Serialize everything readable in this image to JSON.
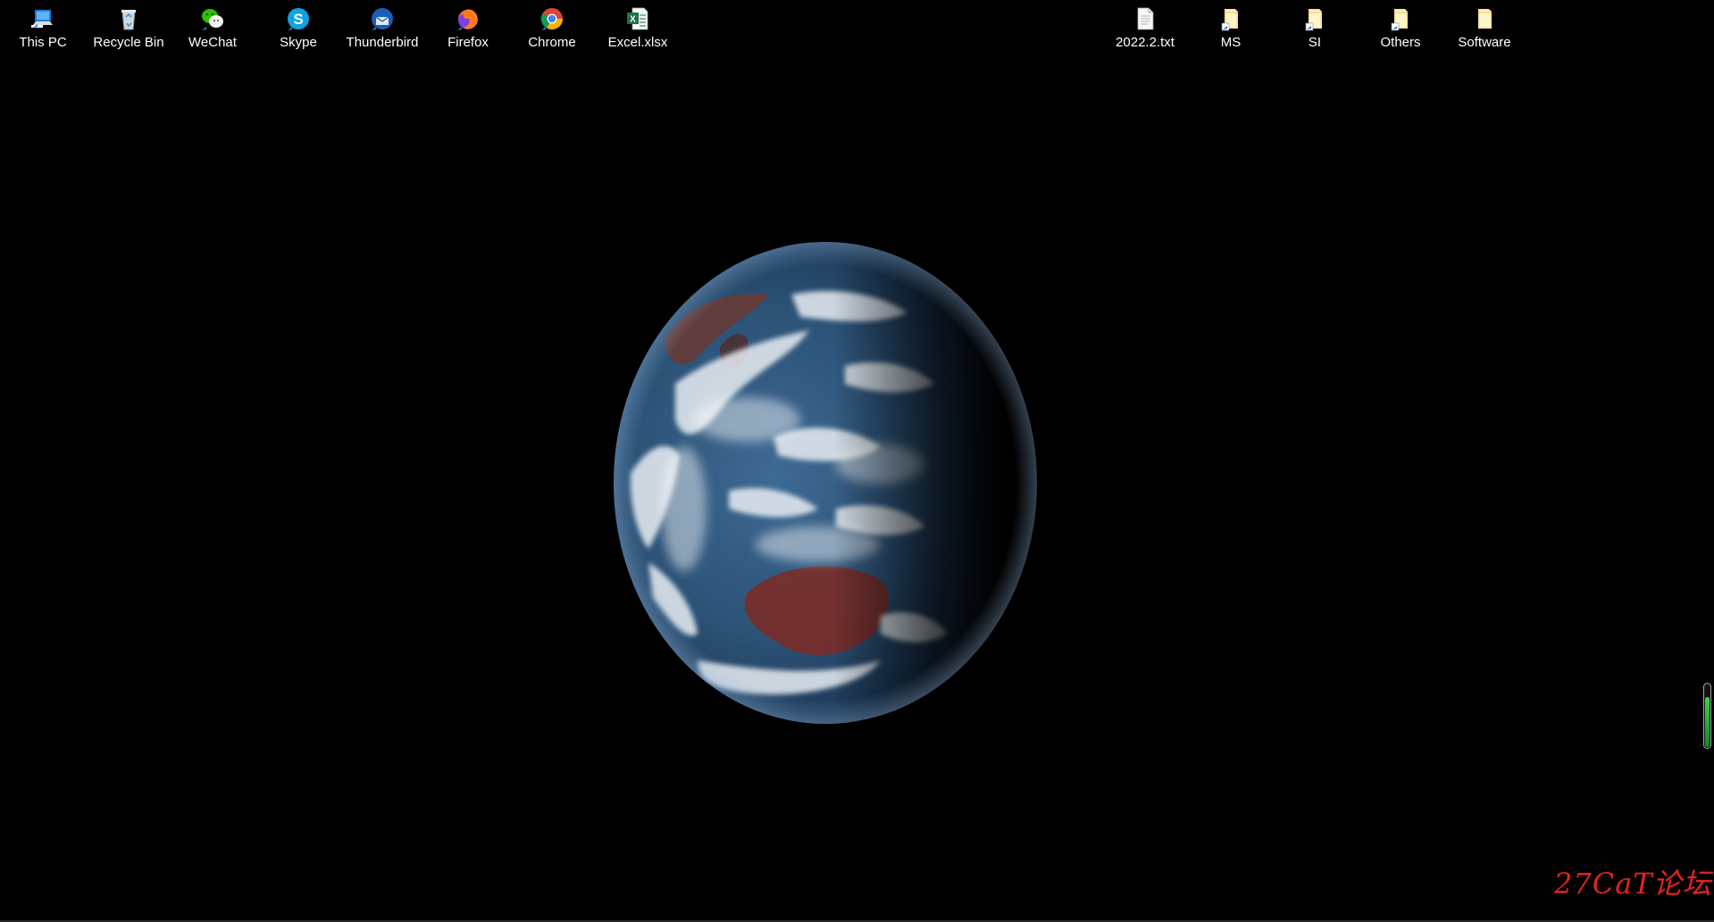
{
  "desktop": {
    "wallpaper": "earth-from-space",
    "background_color": "#000000",
    "left_icons": [
      {
        "label": "This PC",
        "icon": "computer-icon"
      },
      {
        "label": "Recycle Bin",
        "icon": "recycle-bin-icon"
      },
      {
        "label": "WeChat",
        "icon": "wechat-icon"
      },
      {
        "label": "Skype",
        "icon": "skype-icon"
      },
      {
        "label": "Thunderbird",
        "icon": "thunderbird-icon"
      },
      {
        "label": "Firefox",
        "icon": "firefox-icon"
      },
      {
        "label": "Chrome",
        "icon": "chrome-icon"
      },
      {
        "label": "Excel.xlsx",
        "icon": "excel-file-icon"
      }
    ],
    "right_icons": [
      {
        "label": "2022.2.txt",
        "icon": "text-file-icon"
      },
      {
        "label": "MS",
        "icon": "folder-shortcut-icon"
      },
      {
        "label": "SI",
        "icon": "folder-shortcut-icon"
      },
      {
        "label": "Others",
        "icon": "folder-shortcut-icon"
      },
      {
        "label": "Software",
        "icon": "folder-icon"
      }
    ]
  },
  "gauge": {
    "level_percent": 80,
    "color": "#22b43a"
  },
  "watermark": {
    "text": "27CaT论坛",
    "color": "#e4221f"
  }
}
